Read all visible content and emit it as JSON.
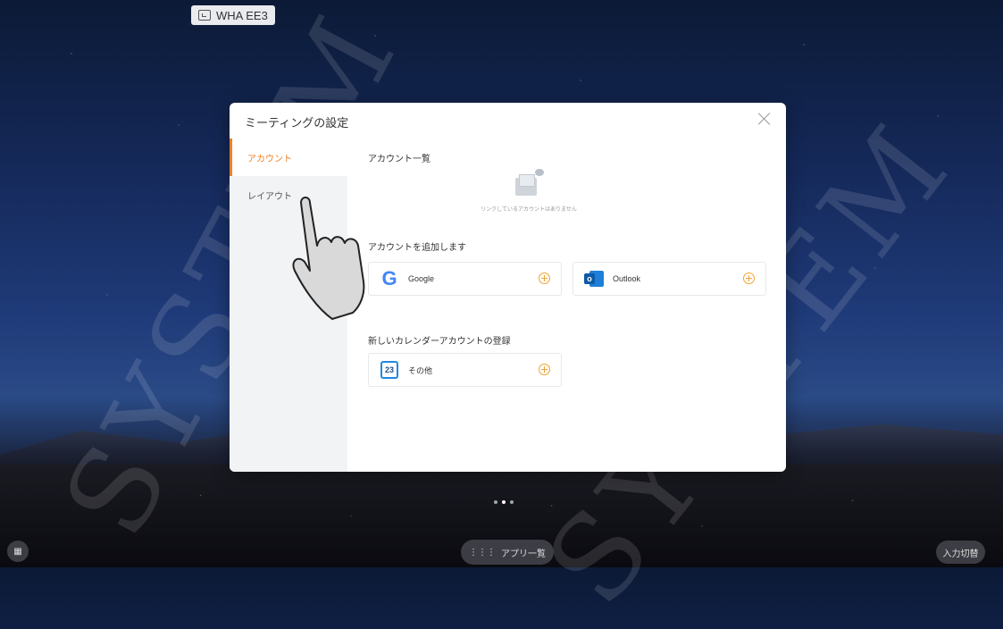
{
  "room": {
    "label": "WHA EE3",
    "icon": "screen-share-icon"
  },
  "dialog": {
    "title": "ミーティングの設定",
    "close_icon": "close-icon",
    "sidebar": [
      {
        "label": "アカウント",
        "active": true
      },
      {
        "label": "レイアウト",
        "active": false
      }
    ],
    "account_list": {
      "heading": "アカウント一覧",
      "empty_text": "リンクしているアカウントはありません",
      "empty_icon": "empty-mailbox-icon"
    },
    "add_account": {
      "heading": "アカウントを追加します",
      "providers": [
        {
          "name": "Google",
          "icon": "google-icon"
        },
        {
          "name": "Outlook",
          "icon": "outlook-icon"
        }
      ]
    },
    "register_calendar": {
      "heading": "新しいカレンダーアカウントの登録",
      "items": [
        {
          "name": "その他",
          "icon": "calendar-icon",
          "icon_text": "23"
        }
      ]
    }
  },
  "taskbar": {
    "app_list_label": "アプリ一覧",
    "input_switch_label": "入力切替"
  },
  "watermark": {
    "text": "SYSTEM"
  },
  "colors": {
    "accent": "#f07f23",
    "plus": "#f2a131"
  }
}
